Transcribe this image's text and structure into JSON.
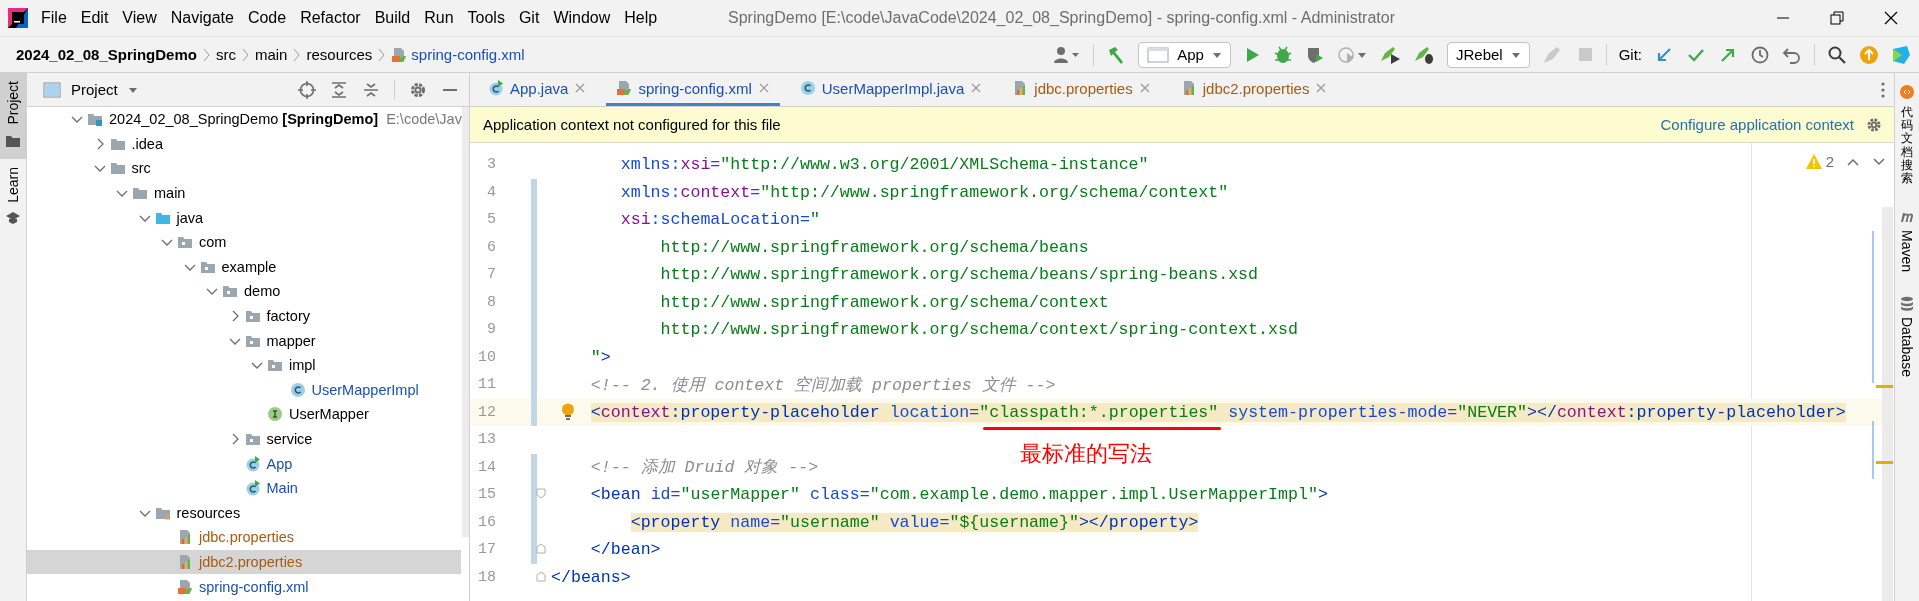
{
  "window": {
    "title": "SpringDemo [E:\\code\\JavaCode\\2024_02_08_SpringDemo] - spring-config.xml - Administrator"
  },
  "menu": [
    "File",
    "Edit",
    "View",
    "Navigate",
    "Code",
    "Refactor",
    "Build",
    "Run",
    "Tools",
    "Git",
    "Window",
    "Help"
  ],
  "breadcrumbs": [
    {
      "label": "2024_02_08_SpringDemo",
      "kind": "project"
    },
    {
      "label": "src",
      "kind": "folder"
    },
    {
      "label": "main",
      "kind": "folder"
    },
    {
      "label": "resources",
      "kind": "folder"
    },
    {
      "label": "spring-config.xml",
      "kind": "file"
    }
  ],
  "toolbar": {
    "run_config": "App",
    "plugin_config": "JRebel",
    "git_label": "Git:"
  },
  "left_strip": [
    {
      "label": "Project",
      "kind": "project",
      "selected": true
    },
    {
      "label": "Learn",
      "kind": "learn",
      "selected": false
    }
  ],
  "project_panel": {
    "title": "Project",
    "tree": [
      {
        "name": "2024_02_08_SpringDemo",
        "module": "[SpringDemo]",
        "path": "E:\\code\\Jav",
        "kind": "module",
        "expanded": true,
        "selected": false,
        "color": "#000000",
        "children": [
          {
            "name": ".idea",
            "kind": "folder",
            "expanded": false,
            "selected": false,
            "color": "#000000"
          },
          {
            "name": "src",
            "kind": "folder",
            "expanded": true,
            "selected": false,
            "color": "#000000",
            "children": [
              {
                "name": "main",
                "kind": "folder",
                "expanded": true,
                "selected": false,
                "color": "#000000",
                "children": [
                  {
                    "name": "java",
                    "kind": "source",
                    "expanded": true,
                    "selected": false,
                    "color": "#000000",
                    "children": [
                      {
                        "name": "com",
                        "kind": "package",
                        "expanded": true,
                        "selected": false,
                        "color": "#000000",
                        "children": [
                          {
                            "name": "example",
                            "kind": "package",
                            "expanded": true,
                            "selected": false,
                            "color": "#000000",
                            "children": [
                              {
                                "name": "demo",
                                "kind": "package",
                                "expanded": true,
                                "selected": false,
                                "color": "#000000",
                                "children": [
                                  {
                                    "name": "factory",
                                    "kind": "package",
                                    "expanded": false,
                                    "selected": false,
                                    "color": "#000000"
                                  },
                                  {
                                    "name": "mapper",
                                    "kind": "package",
                                    "expanded": true,
                                    "selected": false,
                                    "color": "#000000",
                                    "children": [
                                      {
                                        "name": "impl",
                                        "kind": "package",
                                        "expanded": true,
                                        "selected": false,
                                        "color": "#000000",
                                        "children": [
                                          {
                                            "name": "UserMapperImpl",
                                            "kind": "class",
                                            "selected": false,
                                            "color": "#1a4fb5"
                                          }
                                        ]
                                      },
                                      {
                                        "name": "UserMapper",
                                        "kind": "interface",
                                        "selected": false,
                                        "color": "#000000"
                                      }
                                    ]
                                  },
                                  {
                                    "name": "service",
                                    "kind": "package",
                                    "expanded": false,
                                    "selected": false,
                                    "color": "#000000"
                                  },
                                  {
                                    "name": "App",
                                    "kind": "runnable",
                                    "selected": false,
                                    "color": "#1a4fb5"
                                  },
                                  {
                                    "name": "Main",
                                    "kind": "runnable",
                                    "selected": false,
                                    "color": "#1a4fb5"
                                  }
                                ]
                              }
                            ]
                          }
                        ]
                      }
                    ]
                  },
                  {
                    "name": "resources",
                    "kind": "resources",
                    "expanded": true,
                    "selected": false,
                    "color": "#000000",
                    "children": [
                      {
                        "name": "jdbc.properties",
                        "kind": "properties",
                        "selected": false,
                        "color": "#a85a12"
                      },
                      {
                        "name": "jdbc2.properties",
                        "kind": "properties",
                        "selected": true,
                        "color": "#a85a12"
                      },
                      {
                        "name": "spring-config.xml",
                        "kind": "xml",
                        "selected": false,
                        "color": "#1a4fb5"
                      }
                    ]
                  }
                ]
              }
            ]
          }
        ]
      }
    ]
  },
  "tabs": [
    {
      "label": "App.java",
      "kind": "runnable",
      "color": "#1a4fb5",
      "selected": false
    },
    {
      "label": "spring-config.xml",
      "kind": "xml",
      "color": "#1a4fb5",
      "selected": true
    },
    {
      "label": "UserMapperImpl.java",
      "kind": "class",
      "color": "#1a4fb5",
      "selected": false
    },
    {
      "label": "jdbc.properties",
      "kind": "properties",
      "color": "#a85a12",
      "selected": false
    },
    {
      "label": "jdbc2.properties",
      "kind": "properties",
      "color": "#a85a12",
      "selected": false
    }
  ],
  "notification": {
    "message": "Application context not configured for this file",
    "link": "Configure application context"
  },
  "editor": {
    "warnings": "2",
    "lines": [
      {
        "number": "3",
        "text": "       xmlns:xsi=\"http://www.w3.org/2001/XMLSchema-instance\"",
        "changed": false,
        "fold_open": false,
        "fold_close": false,
        "highlighted": false,
        "current": false,
        "bulb": false
      },
      {
        "number": "4",
        "text": "       xmlns:context=\"http://www.springframework.org/schema/context\"",
        "changed": true,
        "fold_open": false,
        "fold_close": false,
        "highlighted": false,
        "current": false,
        "bulb": false
      },
      {
        "number": "5",
        "text": "       xsi:schemaLocation=\"",
        "changed": true,
        "fold_open": false,
        "fold_close": false,
        "highlighted": false,
        "current": false,
        "bulb": false
      },
      {
        "number": "6",
        "text": "           http://www.springframework.org/schema/beans",
        "changed": true,
        "fold_open": false,
        "fold_close": false,
        "highlighted": false,
        "current": false,
        "bulb": false
      },
      {
        "number": "7",
        "text": "           http://www.springframework.org/schema/beans/spring-beans.xsd",
        "changed": true,
        "fold_open": false,
        "fold_close": false,
        "highlighted": false,
        "current": false,
        "bulb": false
      },
      {
        "number": "8",
        "text": "           http://www.springframework.org/schema/context",
        "changed": true,
        "fold_open": false,
        "fold_close": false,
        "highlighted": false,
        "current": false,
        "bulb": false
      },
      {
        "number": "9",
        "text": "           http://www.springframework.org/schema/context/spring-context.xsd",
        "changed": true,
        "fold_open": false,
        "fold_close": false,
        "highlighted": false,
        "current": false,
        "bulb": false
      },
      {
        "number": "10",
        "text": "    \">",
        "changed": true,
        "fold_open": false,
        "fold_close": false,
        "highlighted": false,
        "current": false,
        "bulb": false
      },
      {
        "number": "11",
        "text": "    <!-- 2. 使用 context 空间加载 properties 文件 -->",
        "changed": true,
        "fold_open": false,
        "fold_close": false,
        "highlighted": false,
        "current": false,
        "bulb": false
      },
      {
        "number": "12",
        "text": "    <context:property-placeholder location=\"classpath:*.properties\" system-properties-mode=\"NEVER\"></context:property-placeholder>",
        "changed": true,
        "fold_open": false,
        "fold_close": false,
        "highlighted": true,
        "current": true,
        "bulb": true
      },
      {
        "number": "13",
        "changed": false,
        "fold_open": false,
        "fold_close": false,
        "current": false,
        "bulb": false
      },
      {
        "number": "14",
        "text": "    <!-- 添加 Druid 对象 -->",
        "changed": true,
        "fold_open": false,
        "fold_close": false,
        "highlighted": false,
        "current": false,
        "bulb": false
      },
      {
        "number": "15",
        "text": "    <bean id=\"userMapper\" class=\"com.example.demo.mapper.impl.UserMapperImpl\">",
        "changed": true,
        "fold_open": true,
        "fold_close": false,
        "highlighted": false,
        "current": false,
        "bulb": false
      },
      {
        "number": "16",
        "text": "        <property name=\"username\" value=\"${username}\"></property>",
        "changed": true,
        "fold_open": false,
        "fold_close": false,
        "highlighted": true,
        "current": false,
        "bulb": false
      },
      {
        "number": "17",
        "text": "    </bean>",
        "changed": true,
        "fold_open": false,
        "fold_close": true,
        "highlighted": false,
        "current": false,
        "bulb": false
      },
      {
        "number": "18",
        "text": "</beans>",
        "changed": false,
        "fold_open": false,
        "fold_close": true,
        "highlighted": false,
        "current": false,
        "bulb": false
      }
    ]
  },
  "annotation": {
    "text": "最标准的写法"
  },
  "right_strip": [
    {
      "label": "代码文档搜索",
      "kind": "doc-search"
    },
    {
      "label": "Maven",
      "kind": "maven"
    },
    {
      "label": "Database",
      "kind": "database"
    }
  ]
}
